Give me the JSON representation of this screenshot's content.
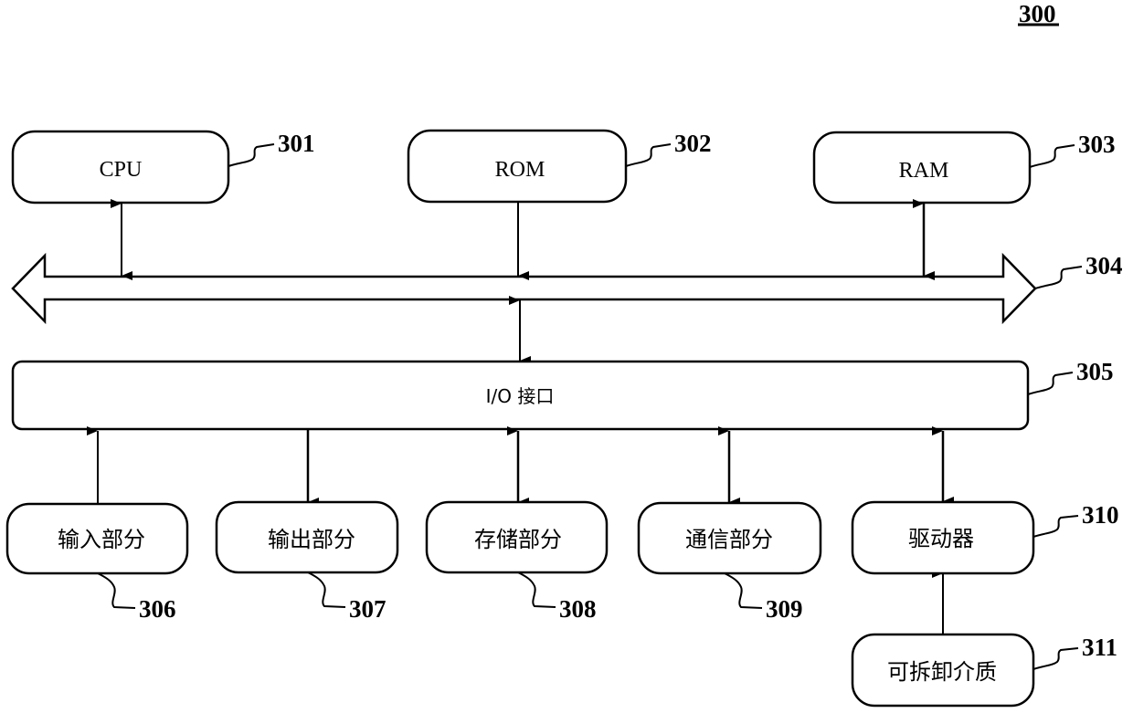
{
  "figure_number": "300",
  "blocks": {
    "cpu": {
      "label": "CPU",
      "ref": "301"
    },
    "rom": {
      "label": "ROM",
      "ref": "302"
    },
    "ram": {
      "label": "RAM",
      "ref": "303"
    },
    "bus": {
      "ref": "304"
    },
    "io": {
      "label": "I/O 接口",
      "ref": "305"
    },
    "input": {
      "label": "输入部分",
      "ref": "306"
    },
    "output": {
      "label": "输出部分",
      "ref": "307"
    },
    "storage": {
      "label": "存储部分",
      "ref": "308"
    },
    "comm": {
      "label": "通信部分",
      "ref": "309"
    },
    "driver": {
      "label": "驱动器",
      "ref": "310"
    },
    "media": {
      "label": "可拆卸介质",
      "ref": "311"
    }
  }
}
